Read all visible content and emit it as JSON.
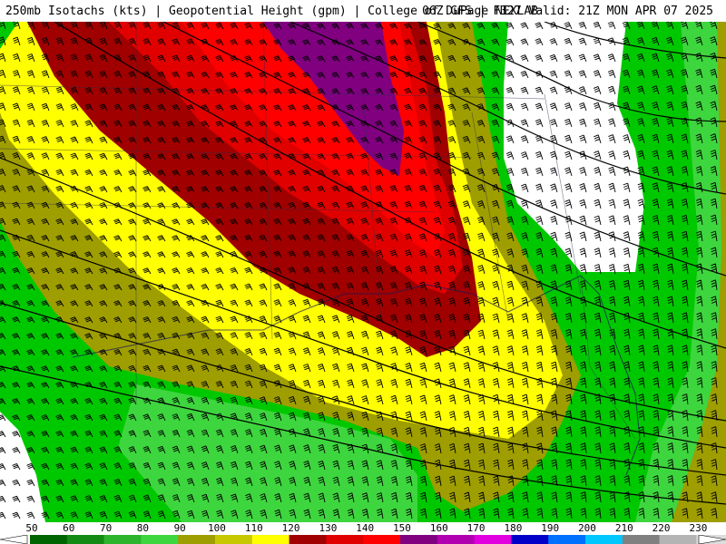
{
  "header": {
    "left": "250mb Isotachs (kts) | Geopotential Height (gpm) | College of DuPage NEXLAB",
    "right": "06Z GFS | F327 Valid: 21Z MON APR 07 2025"
  },
  "colorbar": {
    "labels": [
      "50",
      "60",
      "70",
      "80",
      "90",
      "100",
      "110",
      "120",
      "130",
      "140",
      "150",
      "160",
      "170",
      "180",
      "190",
      "200",
      "210",
      "220",
      "230"
    ],
    "colors": [
      "#006400",
      "#138a13",
      "#2cb42c",
      "#3ed63e",
      "#9e9e00",
      "#c8c800",
      "#ffff00",
      "#a00000",
      "#e00000",
      "#ff0000",
      "#800080",
      "#b000b0",
      "#e000e0",
      "#0000c8",
      "#0070ff",
      "#00c8ff",
      "#808080",
      "#b4b4b4",
      "#dcdcdc"
    ]
  },
  "map": {
    "zones": {
      "fast_green": "#2cb42c",
      "light_green": "#3ed63e",
      "mid_green": "#00c800",
      "olive": "#9e9e00",
      "yellow": "#ffff00",
      "dark_red": "#a00000",
      "red": "#e00000",
      "bright_red": "#ff0000",
      "purple": "#800080",
      "calm": "#ffffff"
    }
  }
}
